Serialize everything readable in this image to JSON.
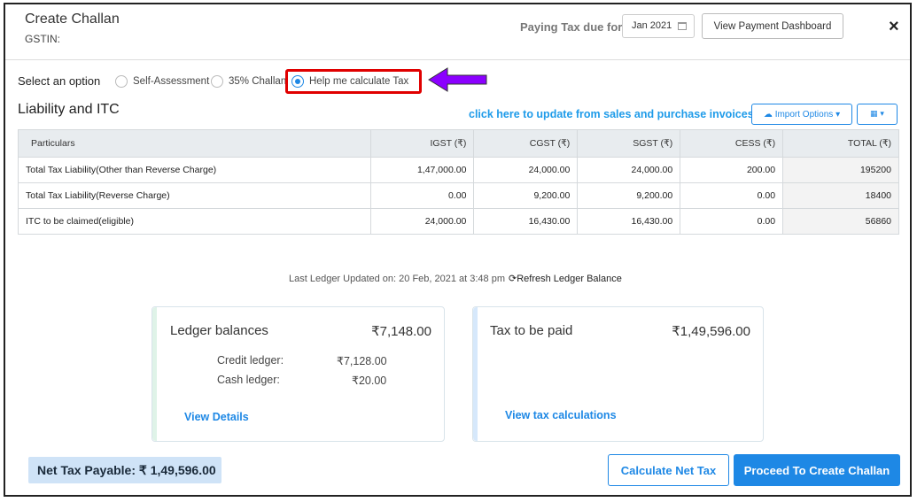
{
  "header": {
    "title": "Create Challan",
    "gstin_label": "GSTIN:",
    "paying_label": "Paying Tax due for",
    "month": "Jan 2021",
    "dashboard_label": "View Payment Dashboard",
    "close": "×"
  },
  "options": {
    "label": "Select an option",
    "items": [
      {
        "label": "Self-Assessment",
        "selected": false
      },
      {
        "label": "35% Challan",
        "selected": false
      },
      {
        "label": "Help me calculate Tax",
        "selected": true
      }
    ]
  },
  "liability": {
    "title": "Liability and ITC",
    "update_link": "click here to update from sales and purchase invoices",
    "import_label": "Import Options",
    "columns": [
      "Particulars",
      "IGST (₹)",
      "CGST (₹)",
      "SGST (₹)",
      "CESS (₹)",
      "TOTAL (₹)"
    ],
    "rows": [
      [
        "Total Tax Liability(Other than Reverse Charge)",
        "1,47,000.00",
        "24,000.00",
        "24,000.00",
        "200.00",
        "195200"
      ],
      [
        "Total Tax Liability(Reverse Charge)",
        "0.00",
        "9,200.00",
        "9,200.00",
        "0.00",
        "18400"
      ],
      [
        "ITC to be claimed(eligible)",
        "24,000.00",
        "16,430.00",
        "16,430.00",
        "0.00",
        "56860"
      ]
    ]
  },
  "ledger_info": {
    "updated_text": "Last Ledger Updated on: 20 Feb, 2021 at 3:48 pm",
    "refresh_label": "Refresh Ledger Balance"
  },
  "ledger_card": {
    "title": "Ledger balances",
    "amount": "₹7,148.00",
    "credit_label": "Credit ledger:",
    "credit_value": "₹7,128.00",
    "cash_label": "Cash ledger:",
    "cash_value": "₹20.00",
    "link": "View Details"
  },
  "tax_card": {
    "title": "Tax to be paid",
    "amount": "₹1,49,596.00",
    "link": "View tax calculations"
  },
  "footer": {
    "net_tax": "Net Tax Payable: ₹ 1,49,596.00",
    "calc_label": "Calculate Net Tax",
    "proceed_label": "Proceed To Create Challan"
  },
  "colors": {
    "accent": "#1e88e5",
    "highlight": "#e00000",
    "arrow": "#8b00ff",
    "ledger_accent": "#dff3e8",
    "tax_accent": "#d6e8fb"
  }
}
